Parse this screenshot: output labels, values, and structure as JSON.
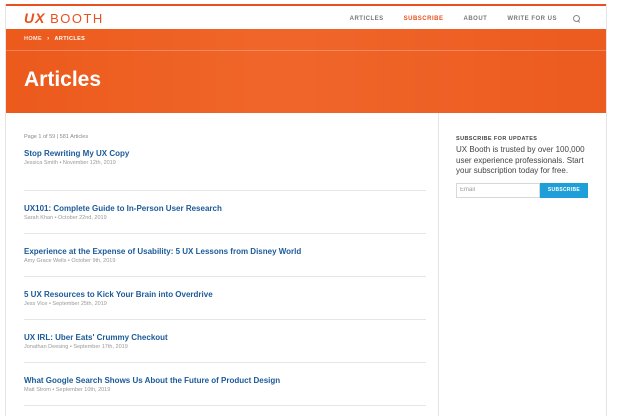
{
  "header": {
    "logo_ux": "UX",
    "logo_booth": "BOOTH",
    "nav": [
      "ARTICLES",
      "SUBSCRIBE",
      "ABOUT",
      "WRITE FOR US"
    ],
    "active_nav": "SUBSCRIBE",
    "search_icon": "search-icon"
  },
  "hero": {
    "breadcrumb_home": "HOME",
    "breadcrumb_separator": "›",
    "breadcrumb_current": "ARTICLES",
    "title": "Articles"
  },
  "main": {
    "page_count": "Page 1 of 59 | 581 Articles",
    "articles": [
      {
        "title": "Stop Rewriting My UX Copy",
        "meta": "Jessica Smith • November 12th, 2019"
      },
      {
        "title": "UX101: Complete Guide to In-Person User Research",
        "meta": "Sarah Khan • October 22nd, 2019"
      },
      {
        "title": "Experience at the Expense of Usability: 5 UX Lessons from Disney World",
        "meta": "Amy Grace Wells • October 9th, 2019"
      },
      {
        "title": "5 UX Resources to Kick Your Brain into Overdrive",
        "meta": "Jess Vice • September 25th, 2019"
      },
      {
        "title": "UX IRL: Uber Eats' Crummy Checkout",
        "meta": "Jonathan Deesing • September 17th, 2019"
      },
      {
        "title": "What Google Search Shows Us About the Future of Product Design",
        "meta": "Matt Strom • September 10th, 2019"
      }
    ]
  },
  "sidebar": {
    "heading": "SUBSCRIBE FOR UPDATES",
    "text": "UX Booth is trusted by over 100,000 user experience professionals. Start your subscription today for free.",
    "email_placeholder": "Email",
    "button_label": "SUBSCRIBE"
  },
  "colors": {
    "brand_orange": "#e8511d",
    "link_blue": "#1b5a99",
    "button_blue": "#1f9fd7"
  }
}
